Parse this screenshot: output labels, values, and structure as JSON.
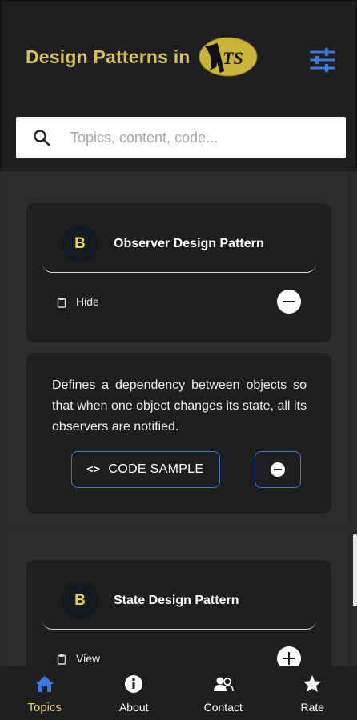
{
  "header": {
    "title": "Design Patterns in",
    "logo_text": "TS",
    "settings_icon": "sliders-icon"
  },
  "search": {
    "placeholder": "Topics, content, code...",
    "icon": "search-icon"
  },
  "topics": [
    {
      "badge": "B",
      "title": "Observer Design Pattern",
      "toggle_label": "Hide",
      "expanded": true,
      "description": "Defines a dependency between objects so that when one object changes its state, all its observers are notified.",
      "code_button_label": "CODE SAMPLE",
      "code_icon": "<>"
    },
    {
      "badge": "B",
      "title": "State Design Pattern",
      "toggle_label": "View",
      "expanded": false
    }
  ],
  "bottom_nav": [
    {
      "label": "Topics",
      "icon": "home-icon",
      "active": true
    },
    {
      "label": "About",
      "icon": "info-icon",
      "active": false
    },
    {
      "label": "Contact",
      "icon": "contact-icon",
      "active": false
    },
    {
      "label": "Rate",
      "icon": "star-icon",
      "active": false
    }
  ],
  "colors": {
    "accent_yellow": "#d6c25a",
    "accent_blue": "#3b7be0",
    "background": "#2b2b2b",
    "card": "#1e1e1e"
  }
}
